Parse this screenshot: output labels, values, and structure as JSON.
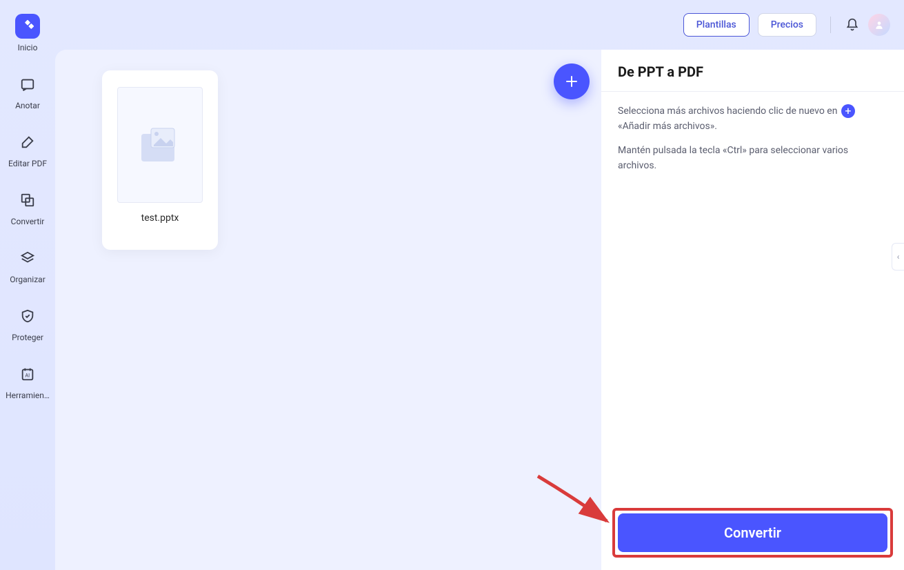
{
  "header": {
    "templates_label": "Plantillas",
    "prices_label": "Precios"
  },
  "sidebar": {
    "items": [
      {
        "label": "Inicio"
      },
      {
        "label": "Anotar"
      },
      {
        "label": "Editar PDF"
      },
      {
        "label": "Convertir"
      },
      {
        "label": "Organizar"
      },
      {
        "label": "Proteger"
      },
      {
        "label": "Herramien…"
      }
    ]
  },
  "workspace": {
    "file_name": "test.pptx"
  },
  "panel": {
    "title": "De PPT a PDF",
    "instruction_prefix": "Selecciona más archivos haciendo clic de nuevo en",
    "instruction_suffix": "«Añadir más archivos».",
    "instruction2": "Mantén pulsada la tecla «Ctrl» para seleccionar varios archivos.",
    "convert_label": "Convertir"
  },
  "collapse_glyph": "‹"
}
